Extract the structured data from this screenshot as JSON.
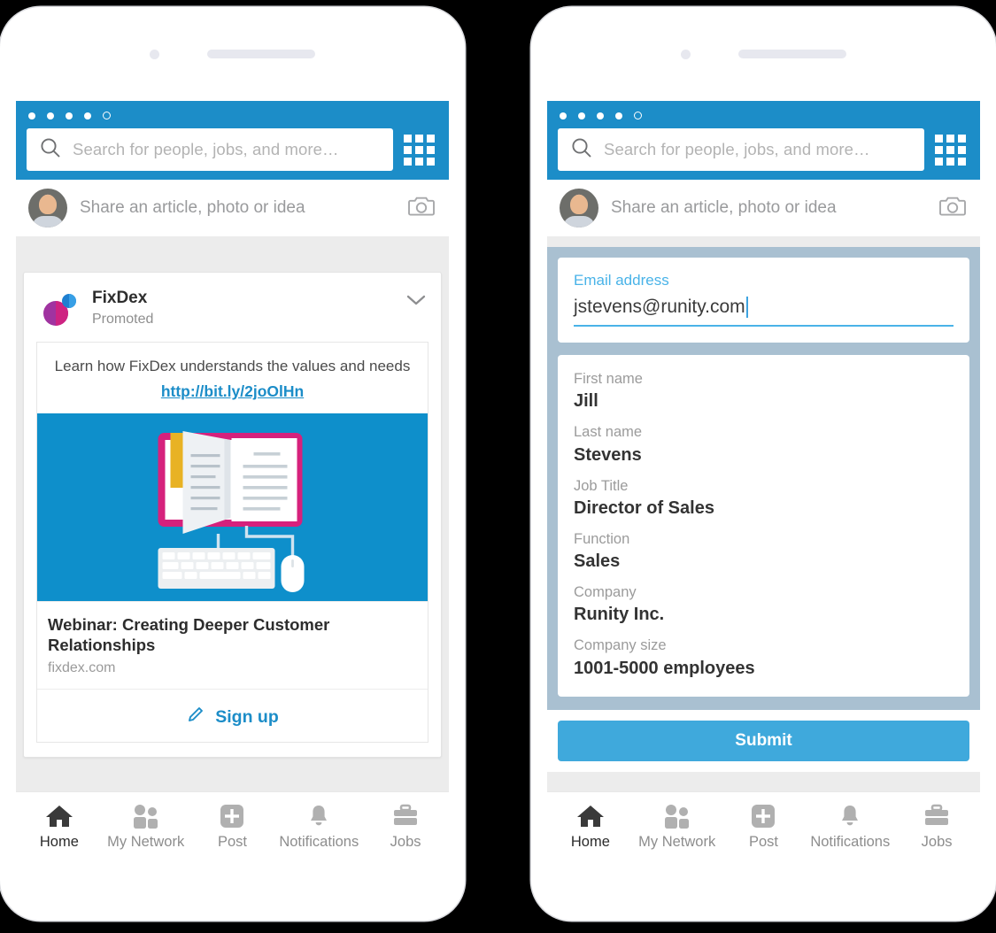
{
  "app": {
    "accent_blue": "#1c8dc8",
    "submit_blue": "#3fa9dc",
    "overlay_blue": "#a9c0d1",
    "screen_bg": "#ececec"
  },
  "header": {
    "search_placeholder": "Search for people, jobs, and more…",
    "signal_dots": 5,
    "signal_filled": 4,
    "grid_icon": "grid-icon",
    "search_icon": "search-icon"
  },
  "share": {
    "placeholder": "Share an article, photo or idea",
    "camera_icon": "camera-icon",
    "avatar": "avatar"
  },
  "ad": {
    "brand": "FixDex",
    "promoted_label": "Promoted",
    "chevron_icon": "chevron-down-icon",
    "copy_line": "Learn how FixDex understands the values and needs",
    "link": "http://bit.ly/2joOlHn",
    "title": "Webinar: Creating Deeper Customer Relationships",
    "domain": "fixdex.com",
    "cta_label": "Sign up",
    "cta_icon": "pencil-icon",
    "image_alt": "open-book-keyboard-mouse-illustration"
  },
  "nav": {
    "items": [
      {
        "label": "Home",
        "icon": "home-icon",
        "active": true
      },
      {
        "label": "My Network",
        "icon": "people-icon",
        "active": false
      },
      {
        "label": "Post",
        "icon": "plus-square-icon",
        "active": false
      },
      {
        "label": "Notifications",
        "icon": "bell-icon",
        "active": false
      },
      {
        "label": "Jobs",
        "icon": "briefcase-icon",
        "active": false
      }
    ]
  },
  "form": {
    "email": {
      "label": "Email address",
      "value": "jstevens@runity.com"
    },
    "fields": [
      {
        "label": "First name",
        "value": "Jill"
      },
      {
        "label": "Last name",
        "value": "Stevens"
      },
      {
        "label": "Job Title",
        "value": "Director of Sales"
      },
      {
        "label": "Function",
        "value": "Sales"
      },
      {
        "label": "Company",
        "value": "Runity Inc."
      },
      {
        "label": "Company size",
        "value": "1001-5000 employees"
      }
    ],
    "submit_label": "Submit"
  }
}
